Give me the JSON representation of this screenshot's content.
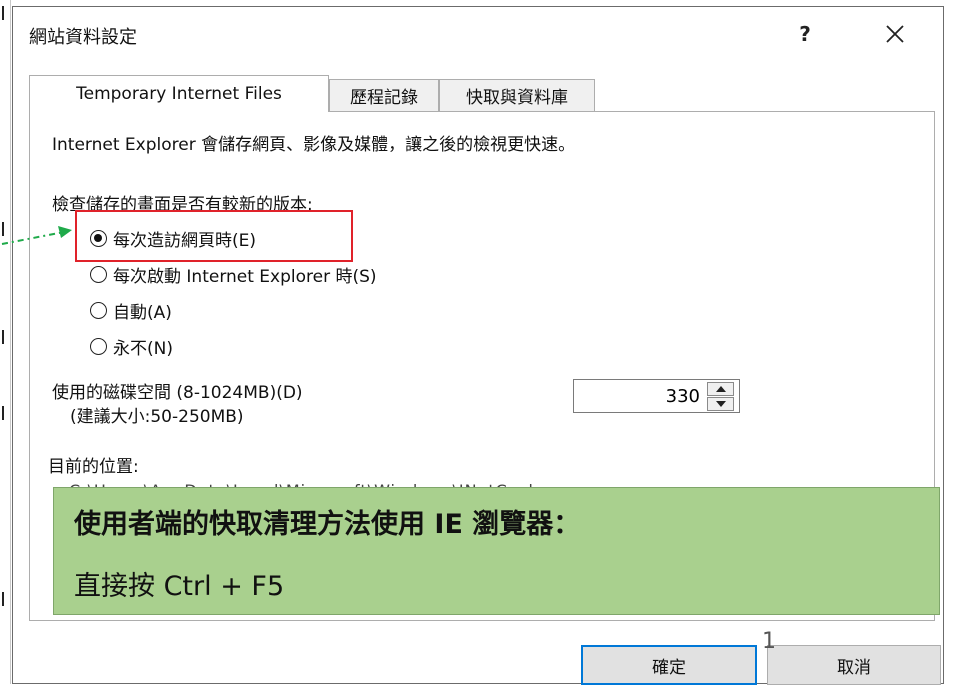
{
  "dialog": {
    "title": "網站資料設定",
    "help_label": "?",
    "close_icon": "close-icon"
  },
  "tabs": [
    {
      "label": "Temporary Internet Files",
      "active": true
    },
    {
      "label": "歷程記錄",
      "active": false
    },
    {
      "label": "快取與資料庫",
      "active": false
    }
  ],
  "panel": {
    "description": "Internet Explorer 會儲存網頁、影像及媒體，讓之後的檢視更快速。",
    "check_heading": "檢查儲存的畫面是否有較新的版本:",
    "radio_options": [
      {
        "label": "每次造訪網頁時(E)",
        "checked": true
      },
      {
        "label": "每次啟動 Internet Explorer 時(S)",
        "checked": false
      },
      {
        "label": "自動(A)",
        "checked": false
      },
      {
        "label": "永不(N)",
        "checked": false
      }
    ],
    "disk_space_label": "使用的磁碟空間 (8-1024MB)(D)",
    "disk_space_hint": "(建議大小:50-250MB)",
    "disk_space_value": "330",
    "location_label": "目前的位置:",
    "location_partial": "C:\\Users\\AppData\\Local\\Microsoft\\Windows\\INetCache"
  },
  "annotation": {
    "heading": "使用者端的快取清理方法使用 IE 瀏覽器：",
    "body": "直接按 Ctrl + F5",
    "background_color": "#a9d08e"
  },
  "buttons": {
    "ok": "確定",
    "cancel": "取消"
  },
  "page_number": "1",
  "colors": {
    "highlight": "#e0222a",
    "arrow": "#1faa4a",
    "focus": "#0078d7"
  }
}
